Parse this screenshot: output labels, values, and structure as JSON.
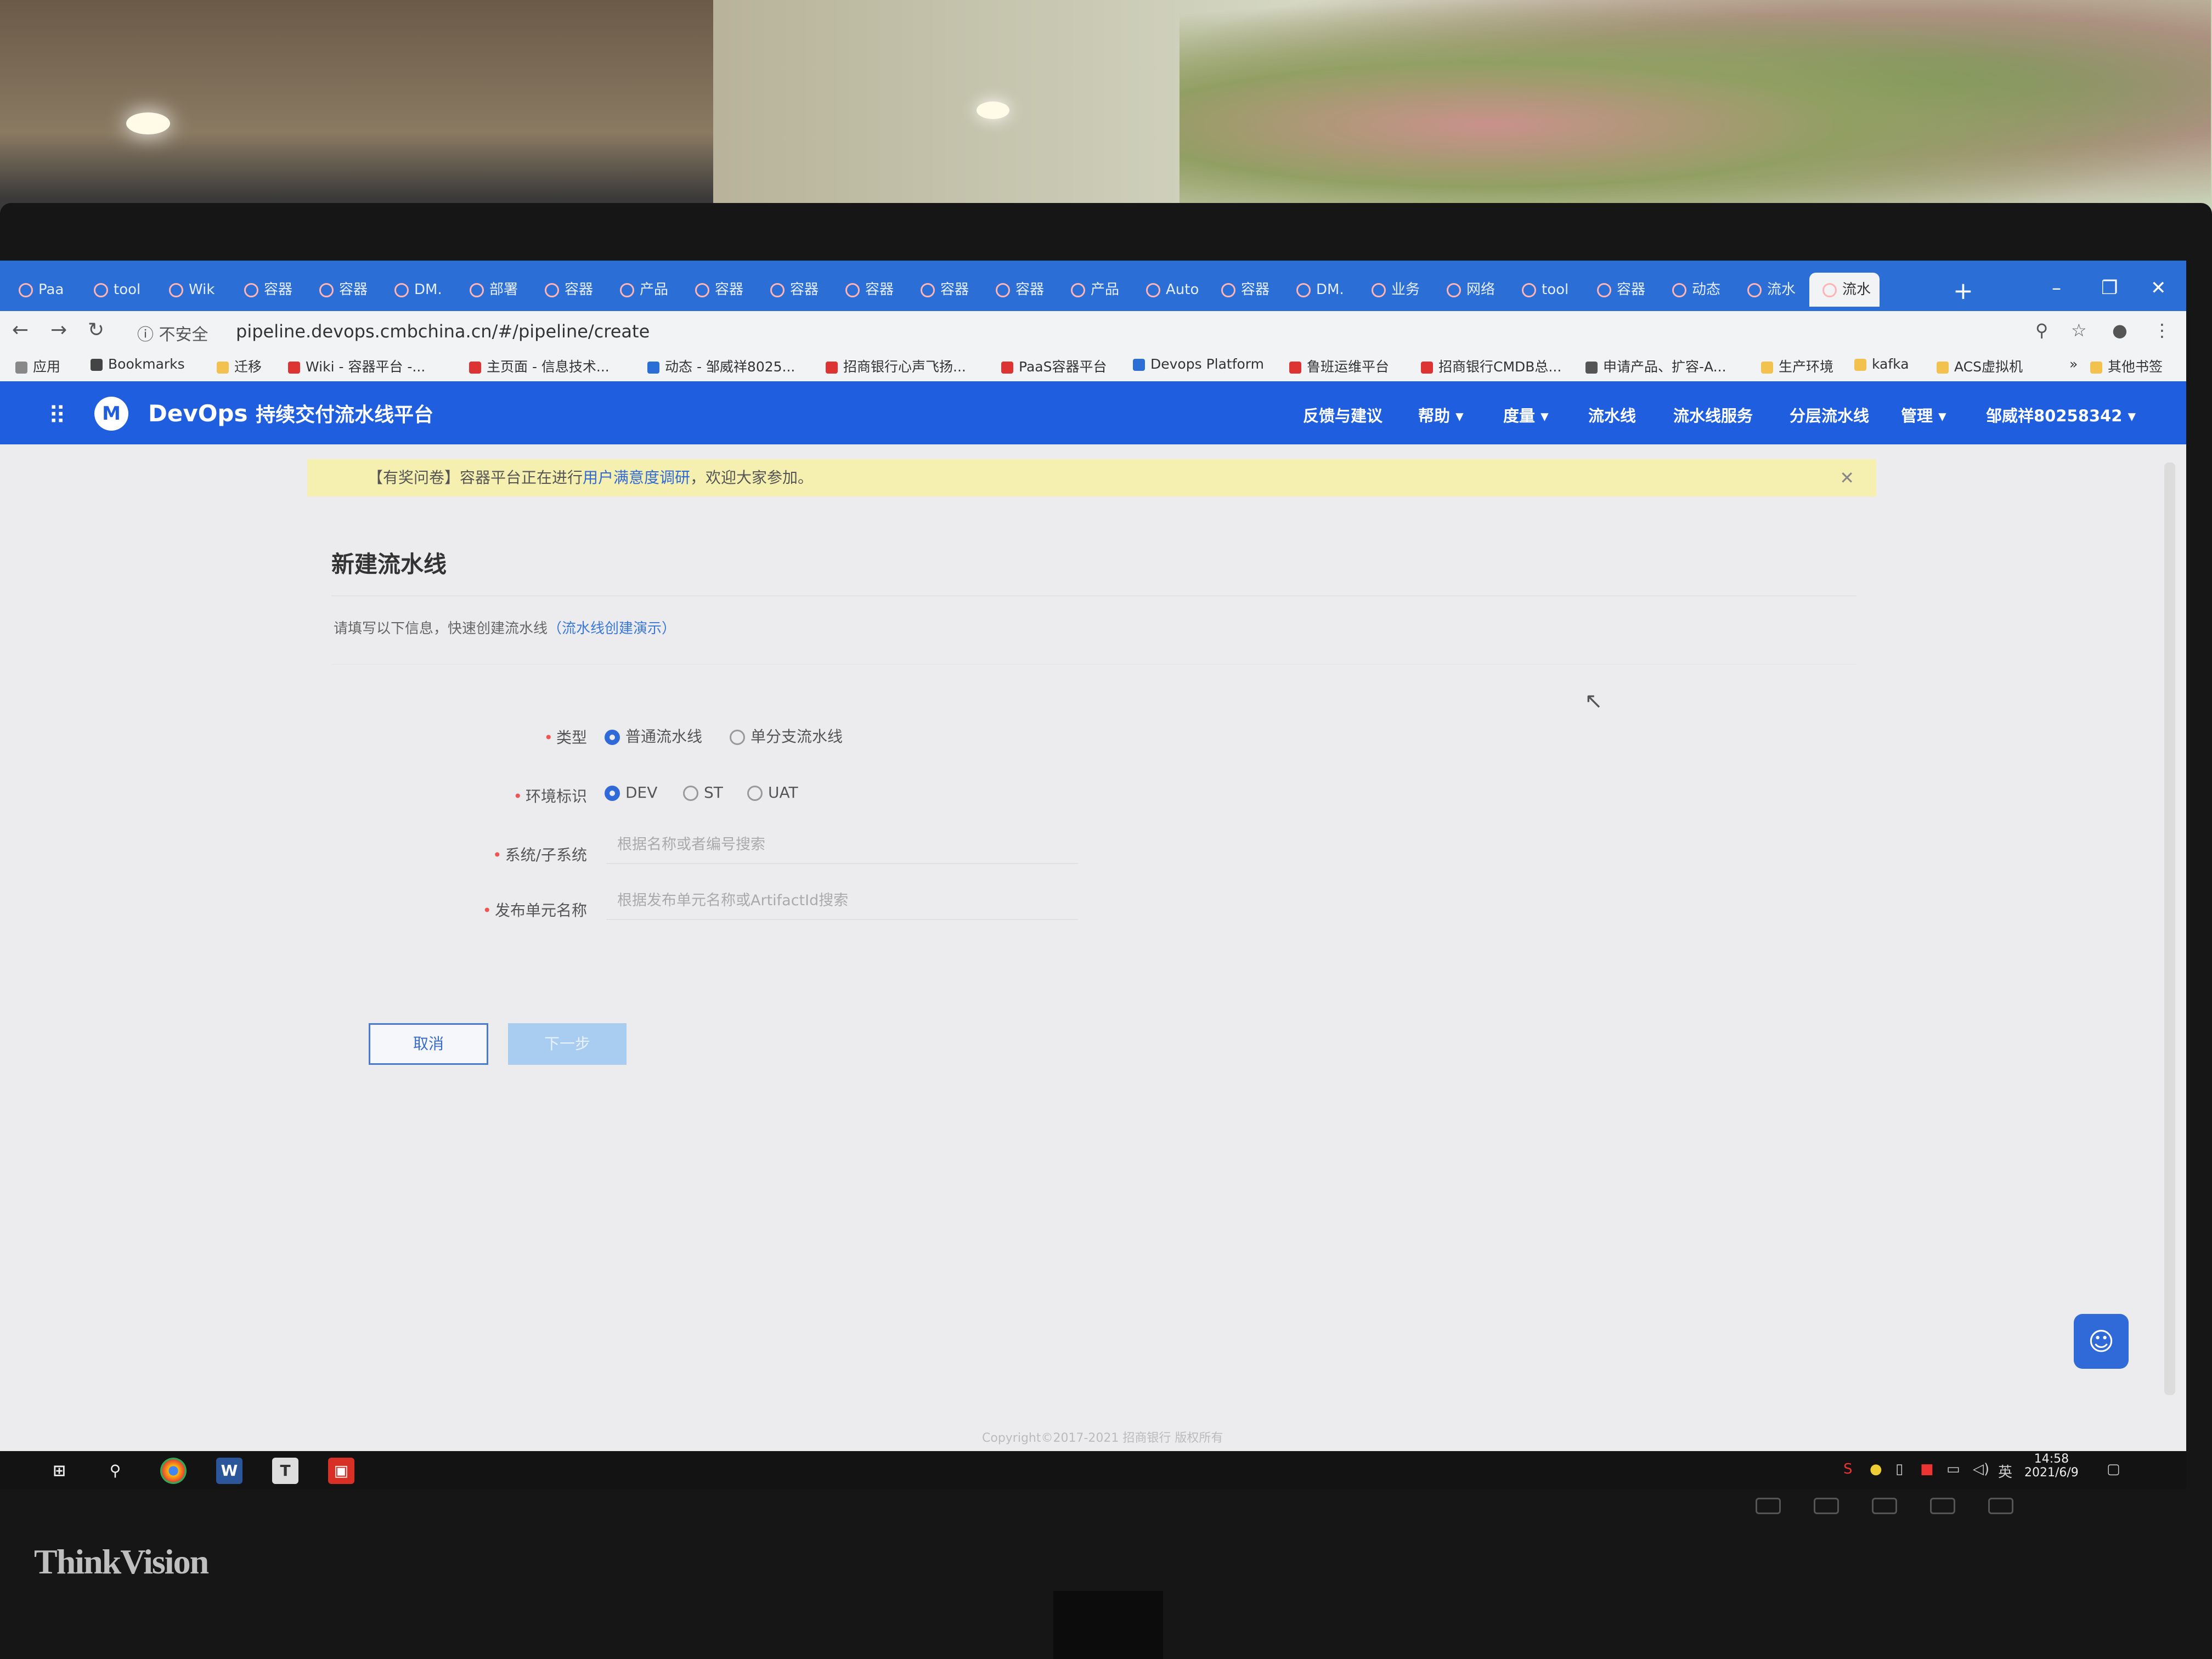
{
  "browser": {
    "tabs": [
      "Paa",
      "tool",
      "Wik",
      "容器",
      "容器",
      "DM.",
      "部署",
      "容器",
      "产品",
      "容器",
      "容器",
      "容器",
      "容器",
      "容器",
      "产品",
      "Auto",
      "容器",
      "DM.",
      "业务",
      "网络",
      "tool",
      "容器",
      "动态",
      "流水",
      "流水"
    ],
    "address": {
      "security_label": "不安全",
      "url": "pipeline.devops.cmbchina.cn/#/pipeline/create"
    },
    "bookmarks": [
      "应用",
      "Bookmarks",
      "迁移",
      "Wiki - 容器平台 -...",
      "主页面 - 信息技术...",
      "动态 - 邹威祥8025...",
      "招商银行心声飞扬...",
      "PaaS容器平台",
      "Devops Platform",
      "鲁班运维平台",
      "招商银行CMDB总...",
      "申请产品、扩容-A...",
      "生产环境",
      "kafka",
      "ACS虚拟机",
      "»",
      "其他书签"
    ]
  },
  "app": {
    "title_brand": "DevOps",
    "title_text": "持续交付流水线平台",
    "nav": [
      "反馈与建议",
      "帮助 ▾",
      "度量 ▾",
      "流水线",
      "流水线服务",
      "分层流水线",
      "管理 ▾",
      "邹威祥80258342 ▾"
    ],
    "notice": {
      "prefix": "【有奖问卷】容器平台正在进行",
      "link": "用户满意度调研",
      "suffix": "，欢迎大家参加。"
    }
  },
  "form": {
    "title": "新建流水线",
    "subtitle": "请填写以下信息，快速创建流水线",
    "demo_link": "（流水线创建演示）",
    "type_label": "类型",
    "type_options": [
      "普通流水线",
      "单分支流水线"
    ],
    "env_label": "环境标识",
    "env_options": [
      "DEV",
      "ST",
      "UAT"
    ],
    "system_label": "系统/子系统",
    "system_placeholder": "根据名称或者编号搜索",
    "unit_label": "发布单元名称",
    "unit_placeholder": "根据发布单元名称或ArtifactId搜索",
    "cancel": "取消",
    "next": "下一步"
  },
  "footer": "Copyright©2017-2021 招商银行 版权所有",
  "taskbar": {
    "time": "14:58",
    "date": "2021/6/9",
    "ime": "英"
  },
  "monitor_brand": "ThinkVision",
  "colors": {
    "header_blue": "#1f5ede",
    "tab_blue": "#2b6fd6",
    "notice_yellow": "#f6f0b0",
    "link_blue": "#2f6ad8"
  }
}
